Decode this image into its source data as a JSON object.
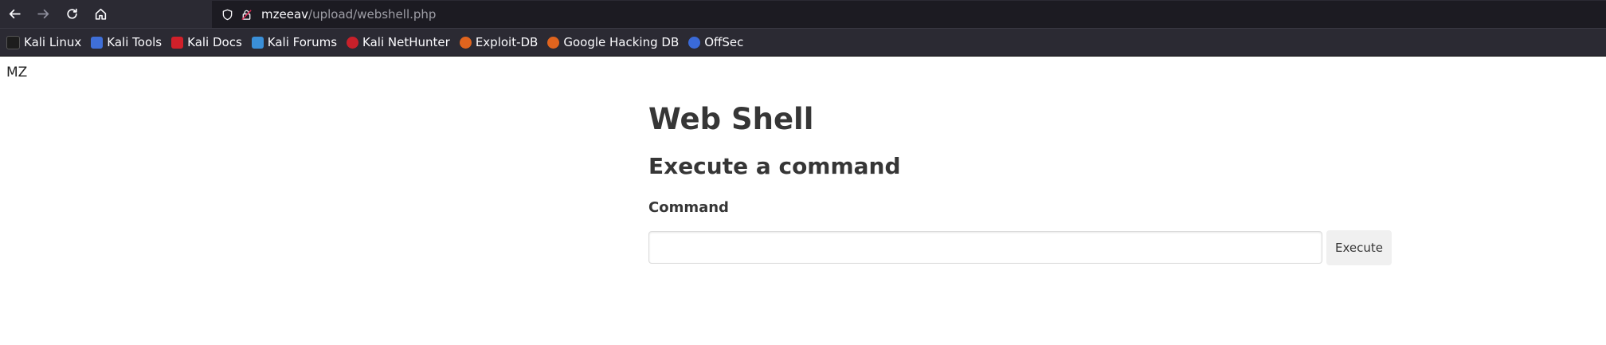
{
  "browser": {
    "url_domain": "mzeeav",
    "url_path": "/upload/webshell.php",
    "bookmarks": [
      {
        "label": "Kali Linux",
        "icon": "kali-dragon-icon",
        "color": "#1d1d1d"
      },
      {
        "label": "Kali Tools",
        "icon": "kali-tools-icon",
        "color": "#3f6fd8"
      },
      {
        "label": "Kali Docs",
        "icon": "kali-docs-icon",
        "color": "#d0202a"
      },
      {
        "label": "Kali Forums",
        "icon": "kali-forums-icon",
        "color": "#3a8fd8"
      },
      {
        "label": "Kali NetHunter",
        "icon": "nethunter-icon",
        "color": "#c8202a"
      },
      {
        "label": "Exploit-DB",
        "icon": "exploit-db-icon",
        "color": "#e0641e"
      },
      {
        "label": "Google Hacking DB",
        "icon": "ghdb-icon",
        "color": "#e0641e"
      },
      {
        "label": "OffSec",
        "icon": "offsec-icon",
        "color": "#3a6ad8"
      }
    ]
  },
  "page": {
    "prefix_text": "MZ",
    "title": "Web Shell",
    "subtitle": "Execute a command",
    "command_label": "Command",
    "command_value": "",
    "execute_label": "Execute"
  }
}
